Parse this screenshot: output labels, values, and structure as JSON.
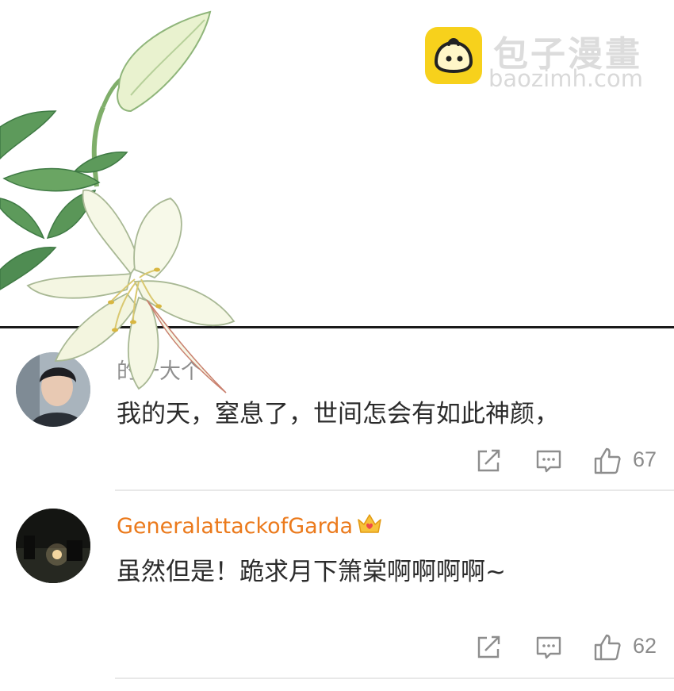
{
  "watermark": {
    "brand_cn": "包子漫畫",
    "domain": "baozimh.com"
  },
  "comments": [
    {
      "username": "的一大个",
      "text": "我的天，窒息了，世间怎会有如此神颜，",
      "likes": "67"
    },
    {
      "username": "GeneralattackofGarda",
      "text": "虽然但是！跪求月下箫棠啊啊啊啊~",
      "likes": "62"
    }
  ],
  "icons": {
    "share": "share-icon",
    "reply": "comment-icon",
    "like": "thumbs-up-icon",
    "vip": "crown-icon"
  },
  "colors": {
    "username_vip": "#eb7a1c",
    "text": "#2b2b2b",
    "muted": "#8b8b8b",
    "logo_yellow": "#f7d11c"
  }
}
